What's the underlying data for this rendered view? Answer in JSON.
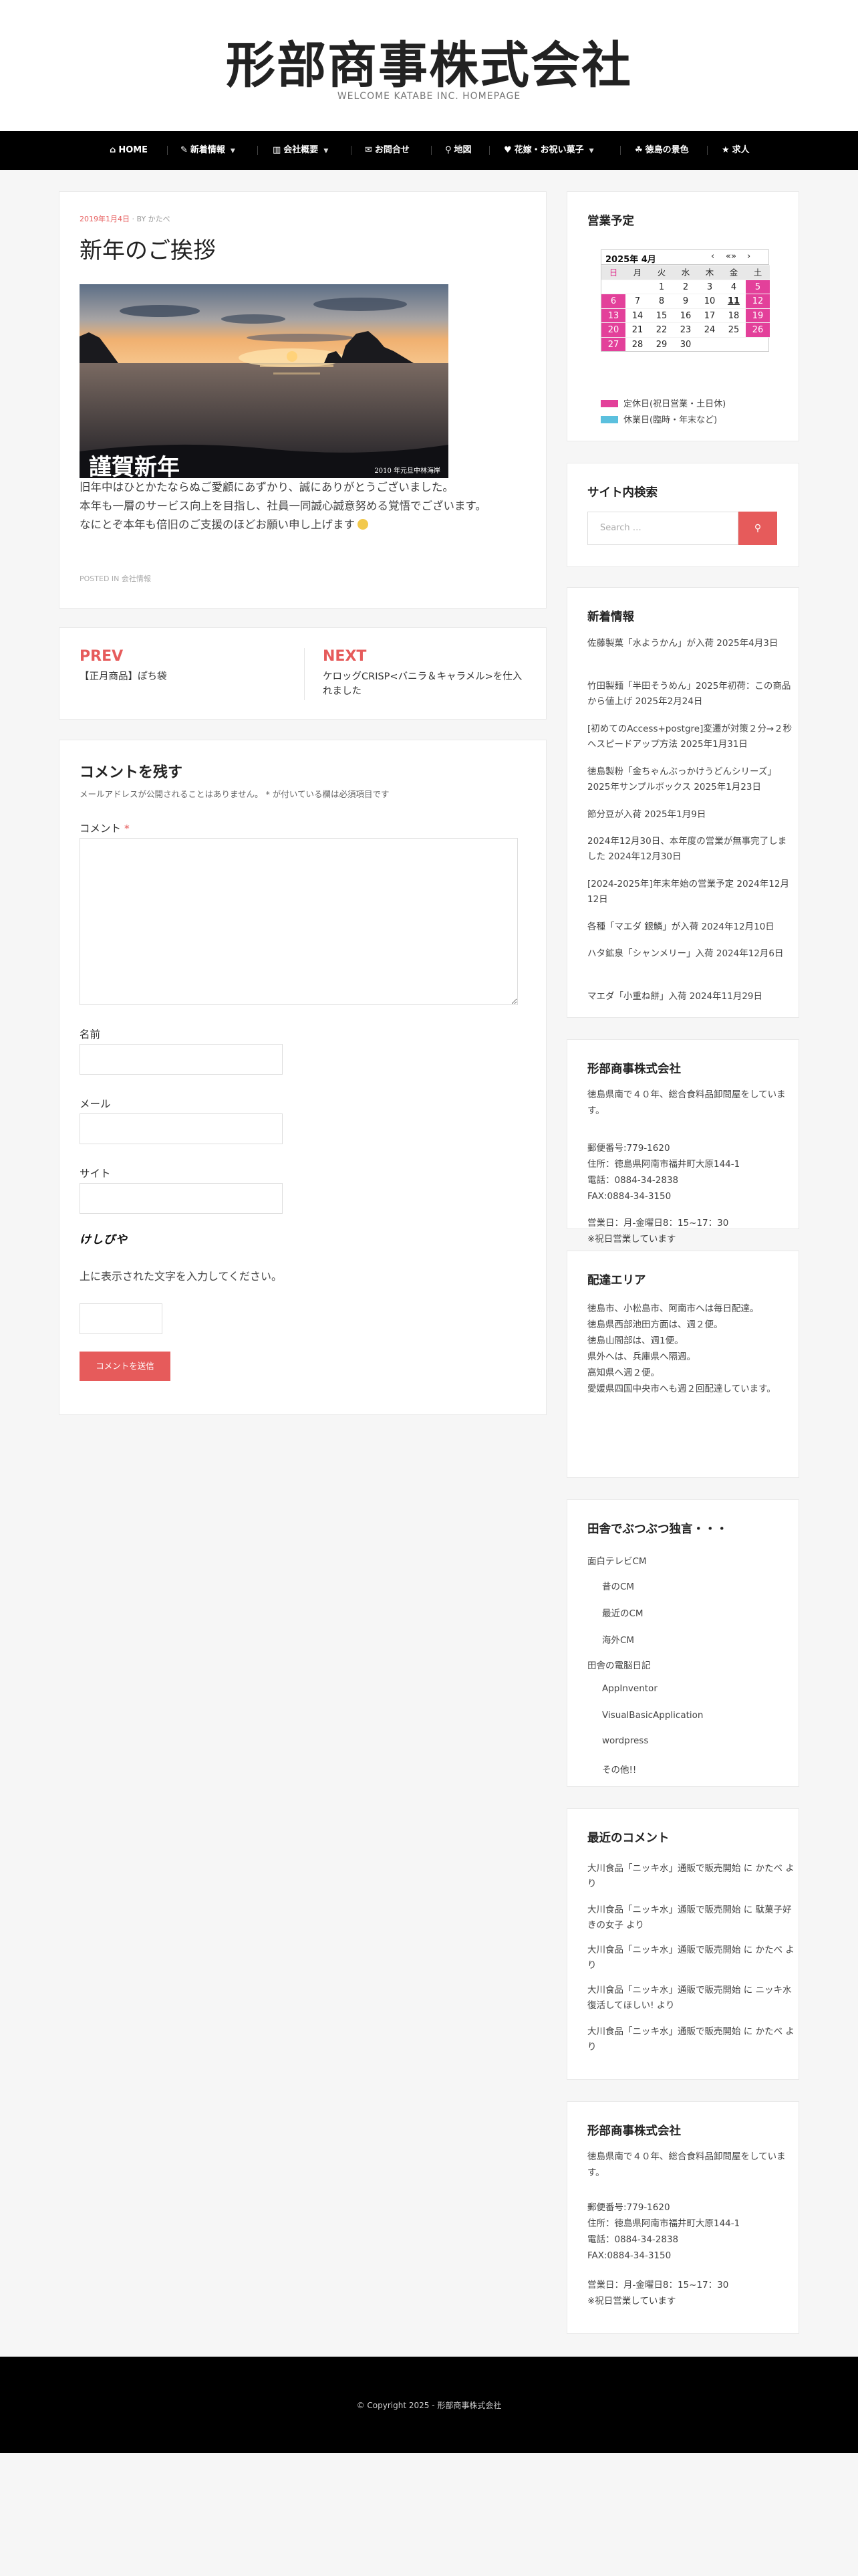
{
  "site": {
    "title": "形部商事株式会社",
    "description": "WELCOME KATABE INC. HOMEPAGE"
  },
  "nav": [
    {
      "label": "HOME",
      "icon": "home-icon",
      "glyph": "⌂"
    },
    {
      "label": "新着情報",
      "icon": "megaphone-icon",
      "glyph": "✎",
      "has_submenu": true
    },
    {
      "label": "会社概要",
      "icon": "bar-chart-icon",
      "glyph": "▥",
      "has_submenu": true
    },
    {
      "label": "お問合せ",
      "icon": "edit-icon",
      "glyph": "✉"
    },
    {
      "label": "地図",
      "icon": "map-marker-icon",
      "glyph": "⚲"
    },
    {
      "label": "花嫁・お祝い菓子",
      "icon": "heart-icon",
      "glyph": "♥",
      "has_submenu": true
    },
    {
      "label": "徳島の景色",
      "icon": "image-icon",
      "glyph": "☘"
    },
    {
      "label": "求人",
      "icon": "star-icon",
      "glyph": "★"
    }
  ],
  "post": {
    "date": "2019年1月4日",
    "author_prefix": "BY",
    "author": "かたべ",
    "title": "新年のご挨拶",
    "image_caption_left": "謹賀新年",
    "image_caption_right": "2010 年元旦中林海岸",
    "body": [
      "旧年中はひとかたならぬご愛顧にあずかり、誠にありがとうございました。",
      "本年も一層のサービス向上を目指し、社員一同誠心誠意努める覚悟でございます。",
      "なにとぞ本年も倍旧のご支援のほどお願い申し上げます"
    ],
    "posted_in_prefix": "POSTED IN",
    "category": "会社情報"
  },
  "post_nav": {
    "prev_label": "PREV",
    "prev_title": "【正月商品】ぽち袋",
    "next_label": "NEXT",
    "next_title": "ケロッグCRISP<バニラ＆キャラメル>を仕入れました"
  },
  "comment_form": {
    "title": "コメントを残す",
    "note": "メールアドレスが公開されることはありません。 * が付いている欄は必須項目です",
    "comment_label": "コメント",
    "required_mark": "*",
    "name_label": "名前",
    "email_label": "メール",
    "site_label": "サイト",
    "captcha_text": "けしびや",
    "captcha_help": "上に表示された文字を入力してください。",
    "submit_label": "コメントを送信"
  },
  "calendar_widget": {
    "title": "営業予定",
    "month_label": "2025年 4月",
    "nav_prev": "‹",
    "nav_today": "«»",
    "nav_next": "›",
    "weekdays": [
      "日",
      "月",
      "火",
      "水",
      "木",
      "金",
      "土"
    ],
    "weeks": [
      [
        "",
        "",
        "1",
        "2",
        "3",
        "4",
        "5"
      ],
      [
        "6",
        "7",
        "8",
        "9",
        "10",
        "11",
        "12"
      ],
      [
        "13",
        "14",
        "15",
        "16",
        "17",
        "18",
        "19"
      ],
      [
        "20",
        "21",
        "22",
        "23",
        "24",
        "25",
        "26"
      ],
      [
        "27",
        "28",
        "29",
        "30",
        "",
        "",
        ""
      ]
    ],
    "today": "11",
    "closed_color": "#e3409a",
    "holiday_color": "#5bc0de",
    "legend_closed": "定休日(祝日営業・土日休)",
    "legend_holiday": "休業日(臨時・年末など)"
  },
  "search_widget": {
    "title": "サイト内検索",
    "placeholder": "Search …"
  },
  "news_widget": {
    "title": "新着情報",
    "items": [
      "佐藤製菓「水ようかん」が入荷 2025年4月3日",
      "竹田製麺「半田そうめん」2025年初荷：この商品から値上げ 2025年2月24日",
      "[初めてのAccess+postgre]変遷が対策２分→２秒へスピードアップ方法 2025年1月31日",
      "徳島製粉「金ちゃんぶっかけうどんシリーズ」2025年サンプルボックス 2025年1月23日",
      "節分豆が入荷 2025年1月9日",
      "2024年12月30日、本年度の営業が無事完了しました 2024年12月30日",
      "[2024-2025年]年末年始の営業予定 2024年12月12日",
      "各種「マエダ 銀鱗」が入荷 2024年12月10日",
      "ハタ鉱泉「シャンメリー」入荷 2024年12月6日",
      "マエダ「小重ね餅」入荷 2024年11月29日"
    ]
  },
  "company_widget": {
    "title": "形部商事株式会社",
    "intro": "徳島県南で４０年、総合食料品卸問屋をしています。",
    "lines": [
      "郵便番号:779-1620",
      "住所：徳島県阿南市福井町大原144-1",
      "電話：0884-34-2838",
      "FAX:0884-34-3150"
    ],
    "hours": [
      "営業日：月-金曜日8：15~17：30",
      "※祝日営業しています"
    ]
  },
  "delivery_widget": {
    "title": "配達エリア",
    "lines": [
      "徳島市、小松島市、阿南市へは毎日配達。",
      "徳島県西部池田方面は、週２便。",
      "徳島山間部は、週1便。",
      "県外へは、兵庫県へ隔週。",
      "高知県へ週２便。",
      "愛媛県四国中央市へも週２回配達しています。"
    ]
  },
  "blog_widget": {
    "title": "田舎でぶつぶつ独言・・・",
    "groups": [
      {
        "label": "面白テレビCM",
        "children": [
          "昔のCM",
          "最近のCM",
          "海外CM"
        ]
      },
      {
        "label": "田舎の電脳日記",
        "children": [
          "AppInventor",
          "VisualBasicApplication",
          "wordpress",
          "その他!!"
        ]
      }
    ]
  },
  "recent_comments_widget": {
    "title": "最近のコメント",
    "items": [
      "大川食品「ニッキ水」通販で販売開始 に かたべ より",
      "大川食品「ニッキ水」通販で販売開始 に 駄菓子好きの女子 より",
      "大川食品「ニッキ水」通販で販売開始 に かたべ より",
      "大川食品「ニッキ水」通販で販売開始 に ニッキ水復活してほしい! より",
      "大川食品「ニッキ水」通販で販売開始 に かたべ より"
    ]
  },
  "company_widget_2": {
    "title": "形部商事株式会社",
    "intro": "徳島県南で４０年、総合食料品卸問屋をしています。",
    "lines": [
      "郵便番号:779-1620",
      "住所：徳島県阿南市福井町大原144-1",
      "電話：0884-34-2838",
      "FAX:0884-34-3150"
    ],
    "hours": [
      "営業日：月-金曜日8：15~17：30",
      "※祝日営業しています"
    ]
  },
  "footer": {
    "copyright": "© Copyright 2025 - 形部商事株式会社"
  },
  "colors": {
    "accent": "#e65b5b",
    "nav_bg": "#000000",
    "footer_bg": "#000000"
  }
}
